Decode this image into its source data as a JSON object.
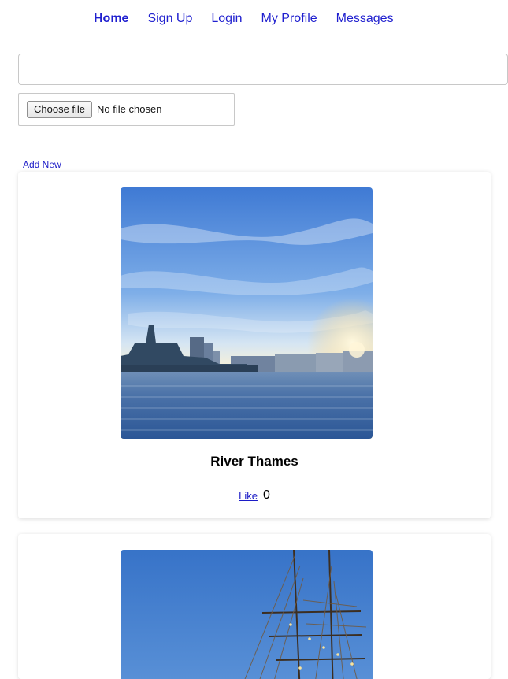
{
  "nav": {
    "items": [
      {
        "label": "Home"
      },
      {
        "label": "Sign Up"
      },
      {
        "label": "Login"
      },
      {
        "label": "My Profile"
      },
      {
        "label": "Messages"
      }
    ]
  },
  "form": {
    "text_input": {
      "value": "",
      "placeholder": ""
    },
    "file_input": {
      "button_label": "Choose file",
      "status": "No file chosen"
    },
    "add_new": "Add New"
  },
  "posts": [
    {
      "title": "River Thames",
      "like_label": "Like",
      "likes": "0"
    },
    {
      "title": "",
      "like_label": "",
      "likes": ""
    }
  ],
  "colors": {
    "link": "#1c1cc7",
    "nav_link": "#1f1fcf",
    "card_shadow": "#e6e6e6",
    "photo_sky_top": "#3f79d3",
    "photo_water": "#2d5a97"
  }
}
